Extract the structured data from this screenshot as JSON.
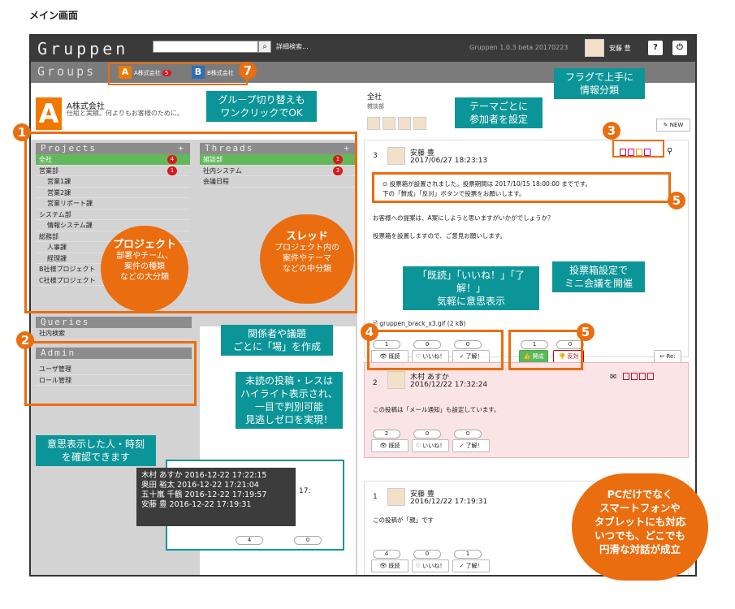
{
  "caption": "メイン画面",
  "app": {
    "logo": "Gruppen",
    "search_icon": "search-icon",
    "advanced_search": "詳細検索...",
    "version": "Gruppen 1.0.3 beta 20170223",
    "user": "安藤 豊",
    "help_icon": "?",
    "power_icon": "⏻"
  },
  "groups": {
    "label": "Groups",
    "items": [
      {
        "letter": "A",
        "name": "A株式会社",
        "count": "5",
        "color": "#f07800"
      },
      {
        "letter": "B",
        "name": "B株式会社",
        "color": "#2f6db5"
      }
    ]
  },
  "company": {
    "letter": "A",
    "name": "A株式会社",
    "tagline": "仕組と実績。何よりもお客様のために。"
  },
  "projects": {
    "title": "Projects",
    "add": "+",
    "items": [
      {
        "label": "全社",
        "badge": "4",
        "sel": true
      },
      {
        "label": "営業部",
        "badge": "1"
      },
      {
        "label": "営業1課",
        "sub": true
      },
      {
        "label": "営業2課",
        "sub": true
      },
      {
        "label": "営業リポート課",
        "sub": true
      },
      {
        "label": "システム部"
      },
      {
        "label": "情報システム課",
        "sub": true
      },
      {
        "label": "総務部"
      },
      {
        "label": "人事課",
        "sub": true
      },
      {
        "label": "経理課",
        "sub": true
      },
      {
        "label": "B社様プロジェクト"
      },
      {
        "label": "C社様プロジェクト"
      }
    ]
  },
  "threads": {
    "title": "Threads",
    "add": "+",
    "items": [
      {
        "label": "雑談部",
        "badge": "1",
        "sel": true
      },
      {
        "label": "社内システム",
        "badge": "3"
      },
      {
        "label": "会議日程"
      }
    ]
  },
  "queries": {
    "title": "Queries",
    "items": [
      {
        "label": "社内検索"
      }
    ]
  },
  "admin": {
    "title": "Admin",
    "items": [
      {
        "label": "ユーザ管理"
      },
      {
        "label": "ロール管理"
      }
    ]
  },
  "thread_header": {
    "title": "全社",
    "subtitle": "雑談部",
    "new_label": "NEW"
  },
  "post1": {
    "no": "3",
    "author": "安藤 豊",
    "date": "2017/06/27 18:23:13",
    "vote_notice": "投票箱が設置されました。投票期間は 2017/10/15 18:00:00 までです。",
    "vote_notice2": "下の「賛成」「反対」ボタンで投票をお願いします。",
    "body1": "お客様への提案は、A案にしようと思いますがいかがでしょうか？",
    "body2": "投票箱を設置しますので、ご意見お願いします。",
    "attachment": "gruppen_brack_x3.gif (2 kB)",
    "counts": [
      "1",
      "0",
      "0"
    ],
    "reactions": [
      "既読",
      "いいね！",
      "了解！"
    ],
    "vote_counts": [
      "1",
      "0"
    ],
    "votes": [
      "賛成",
      "反対"
    ],
    "reply": "Re:"
  },
  "post2": {
    "no": "2",
    "author": "木村 あすか",
    "date": "2016/12/22 17:32:24",
    "body": "この投稿は「メール通知」も設定しています。",
    "counts": [
      "2",
      "0",
      "0"
    ],
    "reactions": [
      "既読",
      "いいね！",
      "了解！"
    ]
  },
  "post3": {
    "no": "1",
    "author": "安藤 豊",
    "date": "2016/12/22 17:19:31",
    "body": "この投稿が「親」です",
    "counts": [
      "4",
      "0",
      "1"
    ],
    "reactions": [
      "既読",
      "いいね！",
      "了解！"
    ]
  },
  "tooltip": {
    "rows": [
      "木村 あすか 2016-12-22 17:22:15",
      "奥田 裕太 2016-12-22 17:21:04",
      "五十嵐 千鶴 2016-12-22 17:19:57",
      "安藤 豊 2016-12-22 17:19:31"
    ],
    "counts": [
      "4",
      "0"
    ],
    "trail": "17:"
  },
  "annotations": {
    "group_switch": "グループ切り替えも\nワンクリックでOK",
    "theme_members": "テーマごとに\n参加者を設定",
    "flags": "フラグで上手に\n情報分類",
    "project_title": "プロジェクト",
    "project_desc": "部署やチーム、\n案件の種類\nなどの大分類",
    "thread_title": "スレッド",
    "thread_desc": "プロジェクト内の\n案件やテーマ\nなどの中分類",
    "place": "関係者や議題\nごとに「場」を作成",
    "reactions": "「既読」「いいね！」「了解！」\n気軽に意思表示",
    "vote": "投票箱設定で\nミニ会議を開催",
    "unread": "未読の投稿・レスは\nハイライト表示され、\n一目で判別可能\n見逃しゼロを実現！",
    "who": "意思表示した人・時刻\nを確認できます",
    "circle": "PCだけでなく\nスマートフォンや\nタブレットにも対応\nいつでも、どこでも\n円滑な対話が成立",
    "n1": "1",
    "n2": "2",
    "n3": "3",
    "n4": "4",
    "n5": "5",
    "n7": "7"
  }
}
